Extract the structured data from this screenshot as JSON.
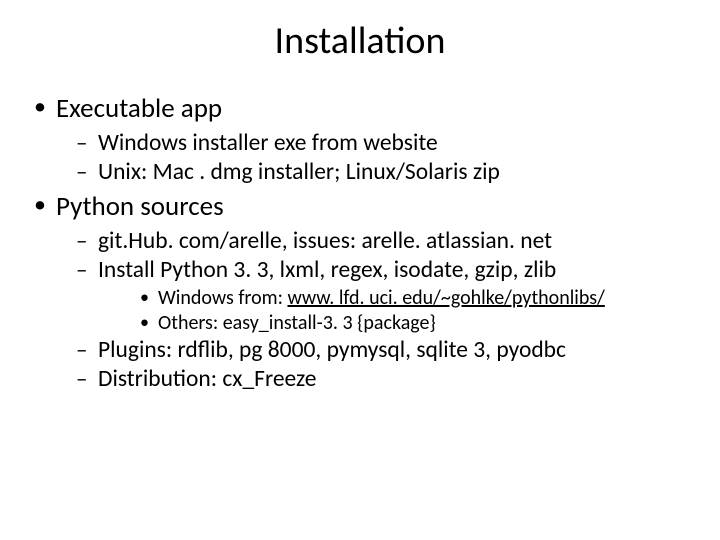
{
  "title": "Installation",
  "bullets": {
    "b1": "Executable app",
    "b1_1": "Windows installer exe from website",
    "b1_2": "Unix: Mac . dmg installer; Linux/Solaris zip",
    "b2": "Python sources",
    "b2_1": "git.Hub. com/arelle, issues: arelle. atlassian. net",
    "b2_2": "Install Python 3. 3, lxml, regex, isodate, gzip, zlib",
    "b2_2_1_prefix": "Windows from: ",
    "b2_2_1_link": "www. lfd. uci. edu/~gohlke/pythonlibs/",
    "b2_2_2": "Others: easy_install-3. 3 {package}",
    "b2_3": "Plugins: rdflib, pg 8000, pymysql, sqlite 3, pyodbc",
    "b2_4": "Distribution: cx_Freeze"
  }
}
